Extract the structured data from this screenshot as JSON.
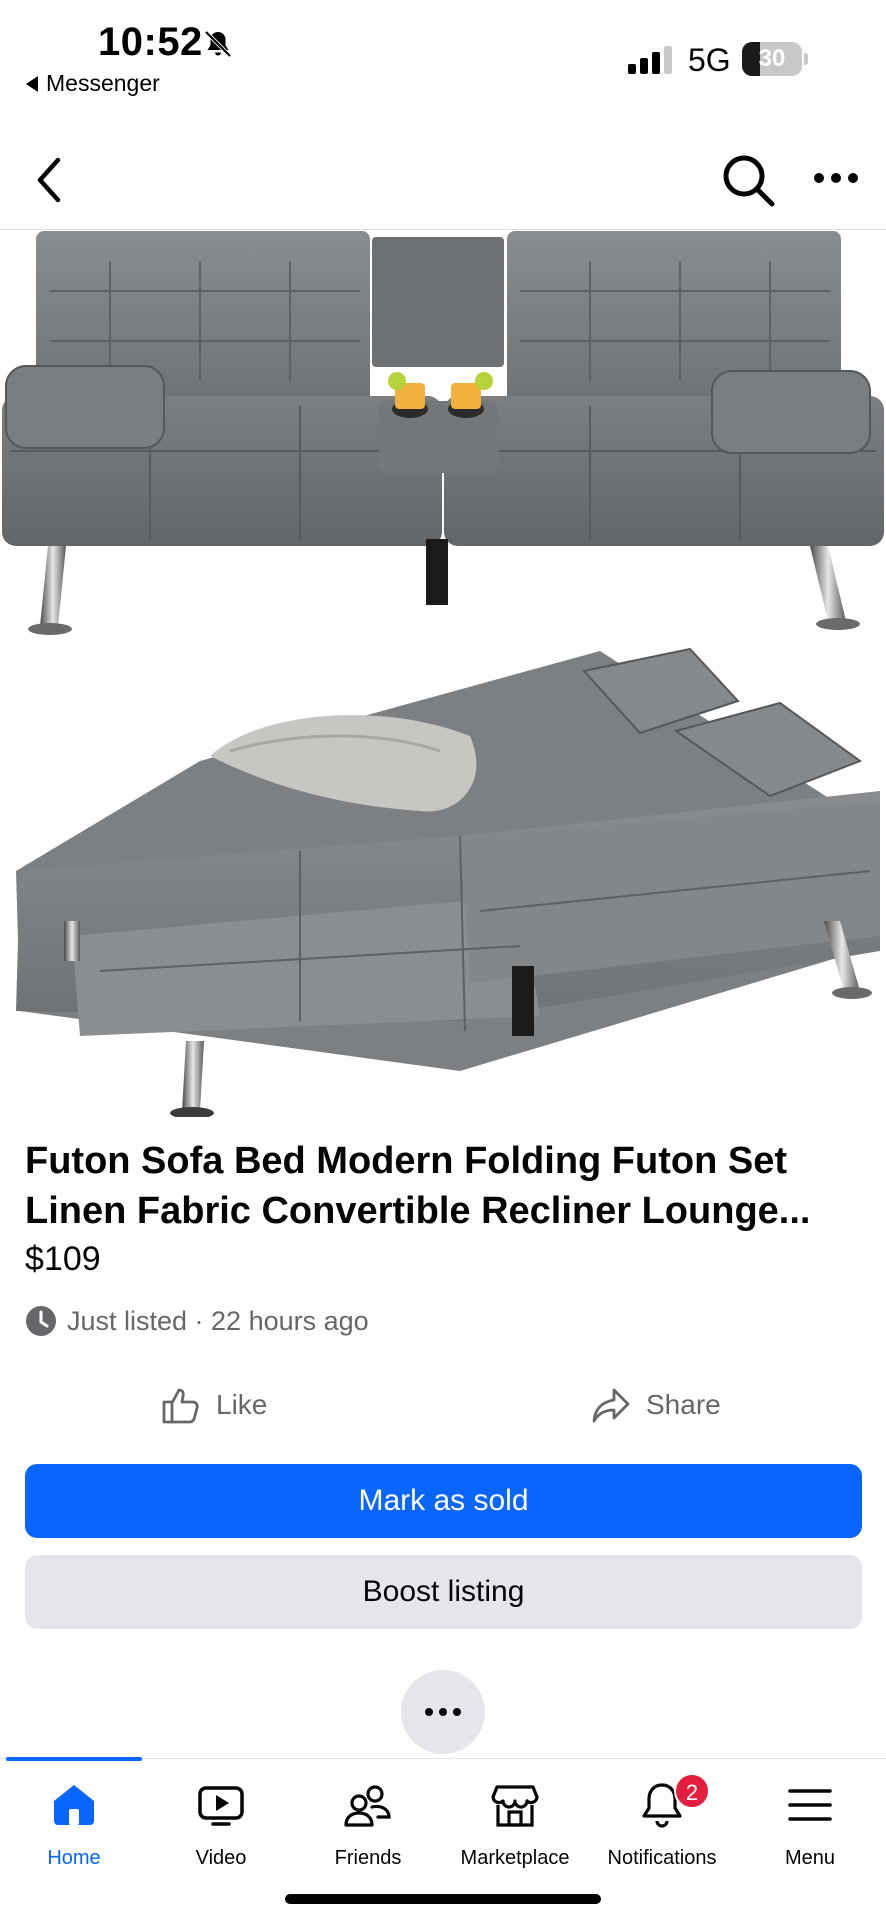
{
  "status_bar": {
    "time": "10:52",
    "back_app": "Messenger",
    "network": "5G",
    "battery": "30",
    "battery_level": 0.3,
    "icons": [
      "bell-slash-icon",
      "cellular-signal-icon",
      "battery-icon"
    ]
  },
  "nav": {
    "icons": [
      "chevron-left-icon",
      "search-icon",
      "more-horizontal-icon"
    ]
  },
  "photo": {
    "slides": 4,
    "current_slide": 1
  },
  "listing": {
    "title_line1": "Futon Sofa Bed Modern Folding Futon Set",
    "title_line2": "Linen Fabric Convertible Recliner Lounge...",
    "price": "$109",
    "listed": "Just listed · 22 hours ago"
  },
  "actions": {
    "like": "Like",
    "share": "Share",
    "mark_sold": "Mark as sold",
    "boost": "Boost listing"
  },
  "tabs": [
    {
      "label": "Home",
      "icon": "home-icon",
      "active": true
    },
    {
      "label": "Video",
      "icon": "video-icon",
      "active": false
    },
    {
      "label": "Friends",
      "icon": "friends-icon",
      "active": false
    },
    {
      "label": "Marketplace",
      "icon": "marketplace-icon",
      "active": false
    },
    {
      "label": "Notifications",
      "icon": "bell-icon",
      "active": false,
      "badge": "2"
    },
    {
      "label": "Menu",
      "icon": "menu-icon",
      "active": false
    }
  ],
  "colors": {
    "accent": "#0866ff",
    "badge": "#e41e3f",
    "secondary_button": "#e4e6eb",
    "muted_text": "#65676b"
  }
}
